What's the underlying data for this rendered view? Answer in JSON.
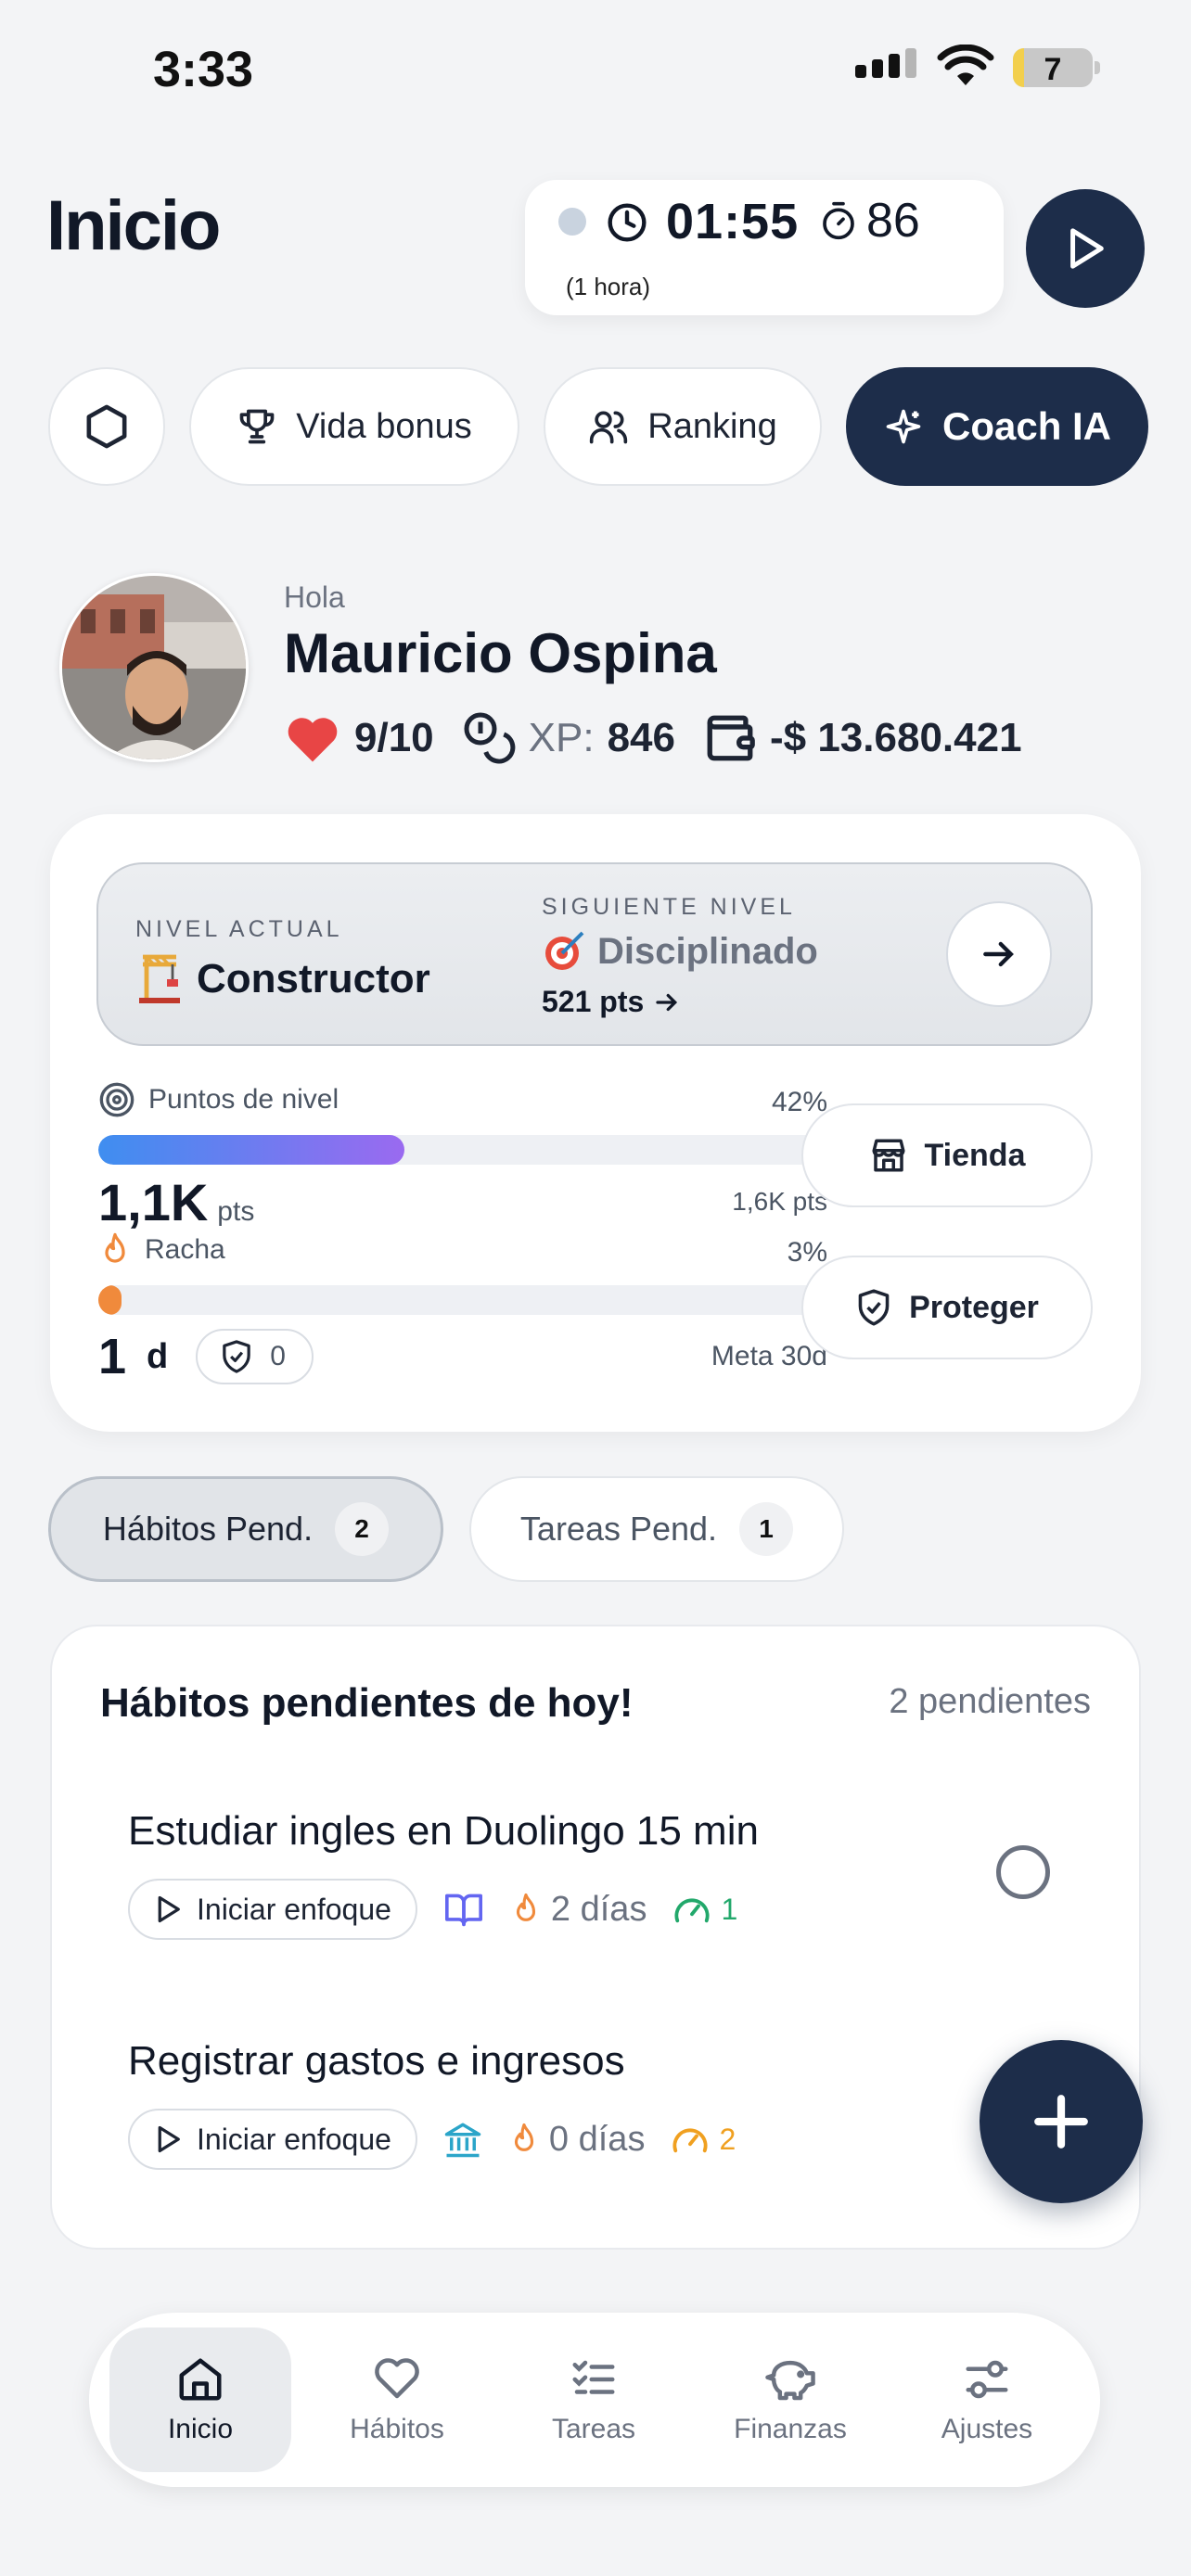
{
  "status_bar": {
    "time": "3:33",
    "battery": "7"
  },
  "header": {
    "title": "Inicio",
    "timer": {
      "time": "01:55",
      "count": "86",
      "hint": "(1 hora)"
    }
  },
  "chips": {
    "vida_bonus": "Vida bonus",
    "ranking": "Ranking",
    "coach": "Coach IA"
  },
  "profile": {
    "greeting": "Hola",
    "name": "Mauricio Ospina",
    "lives": "9/10",
    "xp_label": "XP:",
    "xp_value": "846",
    "balance": "-$ 13.680.421"
  },
  "level": {
    "current_label": "NIVEL ACTUAL",
    "current_name": "Constructor",
    "next_label": "SIGUIENTE NIVEL",
    "next_name": "Disciplinado",
    "next_points": "521 pts",
    "points_label": "Puntos de nivel",
    "points_percent": "42%",
    "points_progress": 0.42,
    "points_value": "1,1K",
    "points_unit": "pts",
    "points_goal": "1,6K pts",
    "streak_label": "Racha",
    "streak_percent": "3%",
    "streak_progress": 0.03,
    "streak_value": "1",
    "streak_unit": "d",
    "shield_count": "0",
    "streak_goal": "Meta 30d",
    "shop_button": "Tienda",
    "protect_button": "Proteger"
  },
  "tabs": [
    {
      "label": "Hábitos Pend.",
      "count": "2"
    },
    {
      "label": "Tareas Pend.",
      "count": "1"
    }
  ],
  "habits": {
    "title": "Hábitos pendientes de hoy!",
    "count_text": "2 pendientes",
    "items": [
      {
        "title": "Estudiar ingles en Duolingo 15 min",
        "focus": "Iniciar enfoque",
        "streak": "2 días",
        "difficulty": "1",
        "category_icon": "book-icon",
        "difficulty_color": "#22a86b",
        "category_color": "#6366f1"
      },
      {
        "title": "Registrar gastos e ingresos",
        "focus": "Iniciar enfoque",
        "streak": "0 días",
        "difficulty": "2",
        "category_icon": "bank-icon",
        "difficulty_color": "#f0a020",
        "category_color": "#2ba5c9"
      }
    ]
  },
  "nav": [
    {
      "label": "Inicio",
      "icon": "home-icon"
    },
    {
      "label": "Hábitos",
      "icon": "heart-icon"
    },
    {
      "label": "Tareas",
      "icon": "checklist-icon"
    },
    {
      "label": "Finanzas",
      "icon": "piggy-bank-icon"
    },
    {
      "label": "Ajustes",
      "icon": "sliders-icon"
    }
  ],
  "colors": {
    "primary": "#1d2d4a",
    "heart": "#e84545",
    "flame": "#f08a3c"
  }
}
